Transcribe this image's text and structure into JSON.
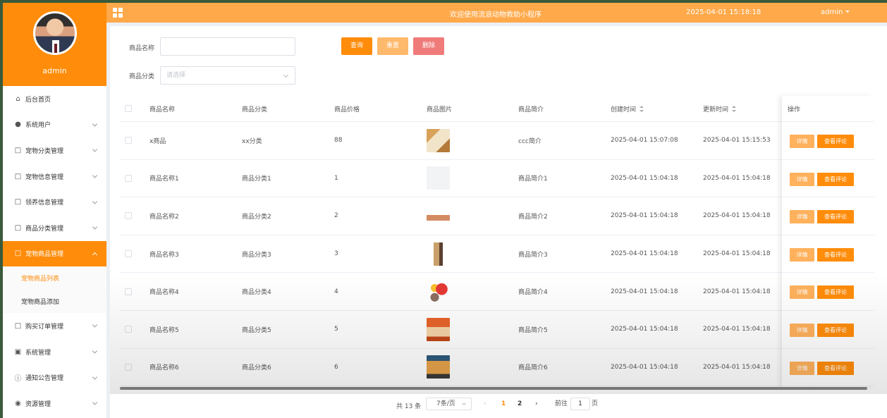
{
  "sidebar": {
    "username": "admin",
    "menu": [
      {
        "label": "后台首页",
        "icon": "home-icon",
        "expand": false
      },
      {
        "label": "系统用户",
        "icon": "user-icon",
        "expand": true
      },
      {
        "label": "宠物分类管理",
        "icon": "doc-icon",
        "expand": true
      },
      {
        "label": "宠物信息管理",
        "icon": "doc-icon",
        "expand": true
      },
      {
        "label": "领养信息管理",
        "icon": "doc-icon",
        "expand": true
      },
      {
        "label": "商品分类管理",
        "icon": "doc-icon",
        "expand": true
      },
      {
        "label": "宠物商品管理",
        "icon": "doc-icon",
        "expand": true,
        "active": true
      },
      {
        "label": "宠物商品列表",
        "sub": true,
        "current": true
      },
      {
        "label": "宠物商品添加",
        "sub": true
      },
      {
        "label": "购买订单管理",
        "icon": "doc-icon",
        "expand": true
      },
      {
        "label": "系统管理",
        "icon": "image-icon",
        "expand": true
      },
      {
        "label": "通知公告管理",
        "icon": "info-icon",
        "expand": true
      },
      {
        "label": "资源管理",
        "icon": "location-icon",
        "expand": true
      }
    ]
  },
  "header": {
    "title": "欢迎使用流浪动物救助小程序",
    "datetime": "2025-04-01 15:18:18",
    "user": "admin"
  },
  "filters": {
    "name_label": "商品名称",
    "name_value": "",
    "category_label": "商品分类",
    "category_placeholder": "请选择",
    "query_button": "查询",
    "reset_button": "重置",
    "delete_button": "删除"
  },
  "table": {
    "headers": [
      "商品名称",
      "商品分类",
      "商品价格",
      "商品图片",
      "商品简介",
      "创建时间",
      "更新时间",
      "操作"
    ],
    "rows": [
      {
        "name": "x商品",
        "category": "xx分类",
        "price": "88",
        "intro": "ccc简介",
        "created": "2025-04-01 15:07:08",
        "updated": "2025-04-01 15:15:53",
        "img": "cat-food-box"
      },
      {
        "name": "商品名称1",
        "category": "商品分类1",
        "price": "1",
        "intro": "商品简介1",
        "created": "2025-04-01 15:04:18",
        "updated": "2025-04-01 15:04:18",
        "img": "blank"
      },
      {
        "name": "商品名称2",
        "category": "商品分类2",
        "price": "2",
        "intro": "商品简介2",
        "created": "2025-04-01 15:04:18",
        "updated": "2025-04-01 15:04:18",
        "img": "treat-bag"
      },
      {
        "name": "商品名称3",
        "category": "商品分类3",
        "price": "3",
        "intro": "商品简介3",
        "created": "2025-04-01 15:04:18",
        "updated": "2025-04-01 15:04:18",
        "img": "pet-bottle"
      },
      {
        "name": "商品名称4",
        "category": "商品分类4",
        "price": "4",
        "intro": "商品简介4",
        "created": "2025-04-01 15:04:18",
        "updated": "2025-04-01 15:04:18",
        "img": "toy-balloon"
      },
      {
        "name": "商品名称5",
        "category": "商品分类5",
        "price": "5",
        "intro": "商品简介5",
        "created": "2025-04-01 15:04:18",
        "updated": "2025-04-01 15:04:18",
        "img": "food-pack"
      },
      {
        "name": "商品名称6",
        "category": "商品分类6",
        "price": "6",
        "intro": "商品简介6",
        "created": "2025-04-01 15:04:18",
        "updated": "2025-04-01 15:04:18",
        "img": "snack-box"
      }
    ],
    "detail_button": "详情",
    "review_button": "查看评论"
  },
  "pagination": {
    "total": "共 13 条",
    "page_size": "7条/页",
    "pages": [
      "1",
      "2"
    ],
    "current_page": "1",
    "goto_label": "前往",
    "goto_value": "1",
    "page_suffix": "页"
  },
  "colors": {
    "accent": "#ff8c0a",
    "header": "#ffa94a",
    "reset": "#ffb96b",
    "delete": "#f07b7b"
  }
}
